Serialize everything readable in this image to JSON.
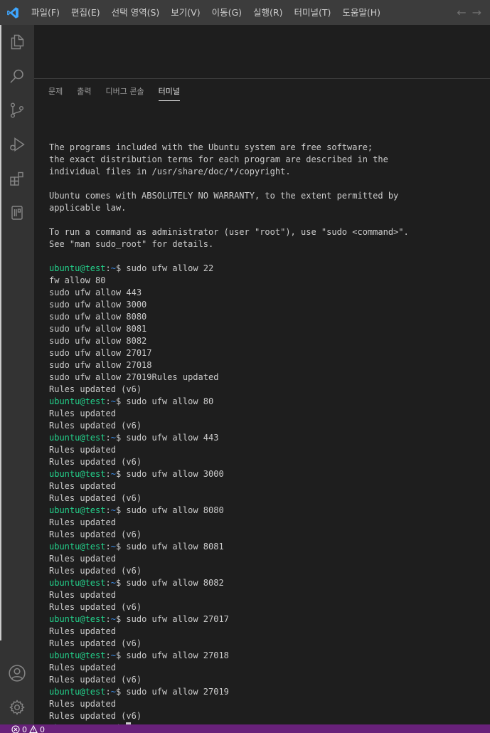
{
  "menu": [
    "파일(F)",
    "편집(E)",
    "선택 영역(S)",
    "보기(V)",
    "이동(G)",
    "실행(R)",
    "터미널(T)",
    "도움말(H)"
  ],
  "nav": {
    "back": "←",
    "forward": "→"
  },
  "panel_tabs": [
    {
      "label": "문제",
      "active": false
    },
    {
      "label": "출력",
      "active": false
    },
    {
      "label": "디버그 콘솔",
      "active": false
    },
    {
      "label": "터미널",
      "active": true
    }
  ],
  "prompt": {
    "user": "ubuntu@test",
    "sep": ":",
    "path": "~",
    "symbol": "$ "
  },
  "terminal_lines": [
    {
      "t": "text",
      "v": ""
    },
    {
      "t": "text",
      "v": "The programs included with the Ubuntu system are free software;"
    },
    {
      "t": "text",
      "v": "the exact distribution terms for each program are described in the"
    },
    {
      "t": "text",
      "v": "individual files in /usr/share/doc/*/copyright."
    },
    {
      "t": "text",
      "v": ""
    },
    {
      "t": "text",
      "v": "Ubuntu comes with ABSOLUTELY NO WARRANTY, to the extent permitted by"
    },
    {
      "t": "text",
      "v": "applicable law."
    },
    {
      "t": "text",
      "v": ""
    },
    {
      "t": "text",
      "v": "To run a command as administrator (user \"root\"), use \"sudo <command>\"."
    },
    {
      "t": "text",
      "v": "See \"man sudo_root\" for details."
    },
    {
      "t": "text",
      "v": ""
    },
    {
      "t": "prompt",
      "v": "sudo ufw allow 22"
    },
    {
      "t": "text",
      "v": "fw allow 80"
    },
    {
      "t": "text",
      "v": "sudo ufw allow 443"
    },
    {
      "t": "text",
      "v": "sudo ufw allow 3000"
    },
    {
      "t": "text",
      "v": "sudo ufw allow 8080"
    },
    {
      "t": "text",
      "v": "sudo ufw allow 8081"
    },
    {
      "t": "text",
      "v": "sudo ufw allow 8082"
    },
    {
      "t": "text",
      "v": "sudo ufw allow 27017"
    },
    {
      "t": "text",
      "v": "sudo ufw allow 27018"
    },
    {
      "t": "text",
      "v": "sudo ufw allow 27019Rules updated"
    },
    {
      "t": "text",
      "v": "Rules updated (v6)"
    },
    {
      "t": "prompt",
      "v": "sudo ufw allow 80"
    },
    {
      "t": "text",
      "v": "Rules updated"
    },
    {
      "t": "text",
      "v": "Rules updated (v6)"
    },
    {
      "t": "prompt",
      "v": "sudo ufw allow 443"
    },
    {
      "t": "text",
      "v": "Rules updated"
    },
    {
      "t": "text",
      "v": "Rules updated (v6)"
    },
    {
      "t": "prompt",
      "v": "sudo ufw allow 3000"
    },
    {
      "t": "text",
      "v": "Rules updated"
    },
    {
      "t": "text",
      "v": "Rules updated (v6)"
    },
    {
      "t": "prompt",
      "v": "sudo ufw allow 8080"
    },
    {
      "t": "text",
      "v": "Rules updated"
    },
    {
      "t": "text",
      "v": "Rules updated (v6)"
    },
    {
      "t": "prompt",
      "v": "sudo ufw allow 8081"
    },
    {
      "t": "text",
      "v": "Rules updated"
    },
    {
      "t": "text",
      "v": "Rules updated (v6)"
    },
    {
      "t": "prompt",
      "v": "sudo ufw allow 8082"
    },
    {
      "t": "text",
      "v": "Rules updated"
    },
    {
      "t": "text",
      "v": "Rules updated (v6)"
    },
    {
      "t": "prompt",
      "v": "sudo ufw allow 27017"
    },
    {
      "t": "text",
      "v": "Rules updated"
    },
    {
      "t": "text",
      "v": "Rules updated (v6)"
    },
    {
      "t": "prompt",
      "v": "sudo ufw allow 27018"
    },
    {
      "t": "text",
      "v": "Rules updated"
    },
    {
      "t": "text",
      "v": "Rules updated (v6)"
    },
    {
      "t": "prompt",
      "v": "sudo ufw allow 27019"
    },
    {
      "t": "text",
      "v": "Rules updated"
    },
    {
      "t": "text",
      "v": "Rules updated (v6)"
    },
    {
      "t": "cursor",
      "v": ""
    }
  ],
  "status": {
    "errors": "0",
    "warnings": "0"
  },
  "colors": {
    "titlebar": "#3c3c3c",
    "activitybar": "#333333",
    "statusbar": "#68217a",
    "prompt_user": "#23d18b",
    "prompt_path": "#3b8eea",
    "vscode_logo": "#3ea6ff"
  },
  "icons": {
    "logo": "vscode-logo-icon",
    "activity": [
      "explorer-icon",
      "search-icon",
      "source-control-icon",
      "run-debug-icon",
      "extensions-icon",
      "remote-explorer-icon",
      "account-icon",
      "gear-icon"
    ]
  }
}
